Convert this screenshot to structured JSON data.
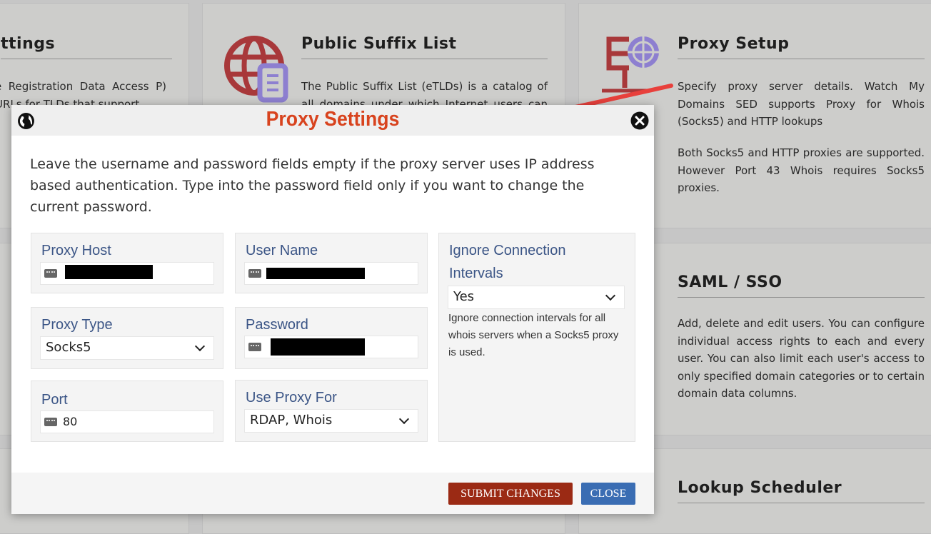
{
  "background_cards": [
    {
      "title": "ttings",
      "text": "e Registration Data Access P) URLs for TLDs that support"
    },
    {
      "title": "Public Suffix List",
      "text": "The Public Suffix List (eTLDs) is a catalog of all domains under which Internet users can (or"
    },
    {
      "title": "Proxy Setup",
      "text": "Specify proxy server details. Watch My Domains SED supports Proxy for Whois (Socks5) and HTTP lookups",
      "text2": "Both Socks5 and HTTP proxies are supported. However Port 43 Whois requires Socks5 proxies."
    },
    {
      "title": "SAML / SSO",
      "text": "Add, delete and edit users. You can configure individual access rights to each and every user. You can also limit each user's access to only specified domain categories or to certain domain data columns."
    },
    {
      "title": "Lookup Scheduler"
    }
  ],
  "modal": {
    "title": "Proxy Settings",
    "description": "Leave the username and password fields empty if the proxy server uses IP address based authentication. Type into the password field only if you want to change the current password.",
    "fields": {
      "proxy_host": {
        "label": "Proxy Host",
        "value": ""
      },
      "user_name": {
        "label": "User Name",
        "value": ""
      },
      "proxy_type": {
        "label": "Proxy Type",
        "value": "Socks5"
      },
      "password": {
        "label": "Password",
        "value": ""
      },
      "port": {
        "label": "Port",
        "value": "80"
      },
      "use_proxy_for": {
        "label": "Use Proxy For",
        "value": "RDAP, Whois"
      },
      "ignore_intervals": {
        "label": "Ignore Connection Intervals",
        "value": "Yes",
        "help": "Ignore connection intervals for all whois servers when a Socks5 proxy is used."
      }
    },
    "buttons": {
      "submit": "SUBMIT CHANGES",
      "close": "CLOSE"
    }
  },
  "colors": {
    "title": "#d8431e",
    "label": "#3b5586",
    "submit": "#9b2a14",
    "close": "#3a6db3",
    "arrow": "#e8403c"
  }
}
